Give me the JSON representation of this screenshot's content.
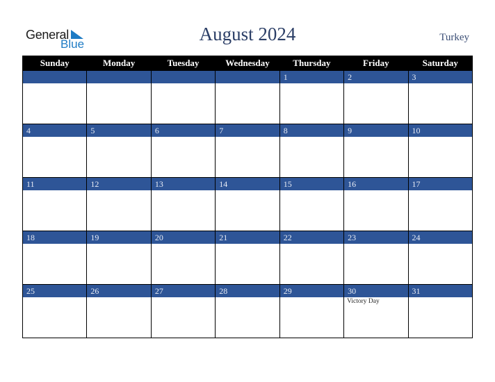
{
  "brand": {
    "line1": "General",
    "line2": "Blue",
    "color": "#1e7bc4"
  },
  "title": "August 2024",
  "country": "Turkey",
  "colors": {
    "header_bg": "#000000",
    "date_bar": "#2e5597",
    "title": "#2b3e66"
  },
  "weekdays": [
    "Sunday",
    "Monday",
    "Tuesday",
    "Wednesday",
    "Thursday",
    "Friday",
    "Saturday"
  ],
  "weeks": [
    [
      {
        "day": ""
      },
      {
        "day": ""
      },
      {
        "day": ""
      },
      {
        "day": ""
      },
      {
        "day": "1"
      },
      {
        "day": "2"
      },
      {
        "day": "3"
      }
    ],
    [
      {
        "day": "4"
      },
      {
        "day": "5"
      },
      {
        "day": "6"
      },
      {
        "day": "7"
      },
      {
        "day": "8"
      },
      {
        "day": "9"
      },
      {
        "day": "10"
      }
    ],
    [
      {
        "day": "11"
      },
      {
        "day": "12"
      },
      {
        "day": "13"
      },
      {
        "day": "14"
      },
      {
        "day": "15"
      },
      {
        "day": "16"
      },
      {
        "day": "17"
      }
    ],
    [
      {
        "day": "18"
      },
      {
        "day": "19"
      },
      {
        "day": "20"
      },
      {
        "day": "21"
      },
      {
        "day": "22"
      },
      {
        "day": "23"
      },
      {
        "day": "24"
      }
    ],
    [
      {
        "day": "25"
      },
      {
        "day": "26"
      },
      {
        "day": "27"
      },
      {
        "day": "28"
      },
      {
        "day": "29"
      },
      {
        "day": "30",
        "holiday": "Victory Day"
      },
      {
        "day": "31"
      }
    ]
  ]
}
